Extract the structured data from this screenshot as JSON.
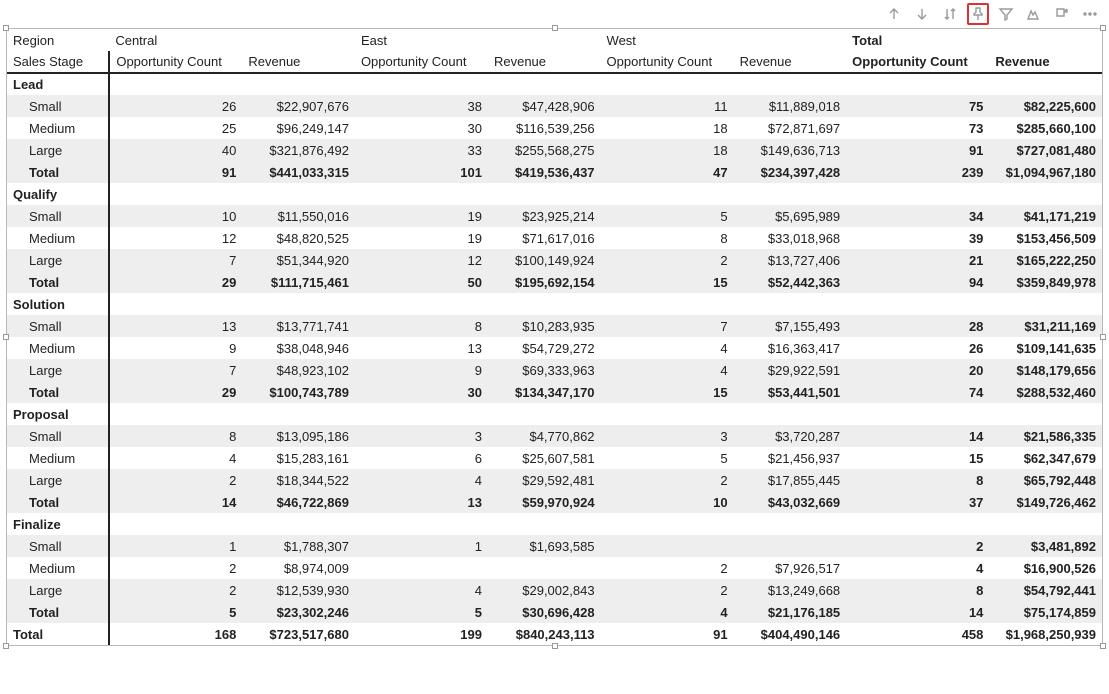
{
  "toolbar": {
    "icons": [
      "up",
      "down",
      "sort",
      "pin",
      "filter",
      "focus",
      "export",
      "more"
    ]
  },
  "headers": {
    "region_label": "Region",
    "sales_stage_label": "Sales Stage",
    "oc_label": "Opportunity Count",
    "rev_label": "Revenue",
    "regions": [
      "Central",
      "East",
      "West",
      "Total"
    ]
  },
  "stages": [
    {
      "name": "Lead",
      "rows": [
        {
          "label": "Small",
          "cells": [
            "26",
            "$22,907,676",
            "38",
            "$47,428,906",
            "11",
            "$11,889,018",
            "75",
            "$82,225,600"
          ]
        },
        {
          "label": "Medium",
          "cells": [
            "25",
            "$96,249,147",
            "30",
            "$116,539,256",
            "18",
            "$72,871,697",
            "73",
            "$285,660,100"
          ]
        },
        {
          "label": "Large",
          "cells": [
            "40",
            "$321,876,492",
            "33",
            "$255,568,275",
            "18",
            "$149,636,713",
            "91",
            "$727,081,480"
          ]
        }
      ],
      "subtotal": {
        "label": "Total",
        "cells": [
          "91",
          "$441,033,315",
          "101",
          "$419,536,437",
          "47",
          "$234,397,428",
          "239",
          "$1,094,967,180"
        ]
      }
    },
    {
      "name": "Qualify",
      "rows": [
        {
          "label": "Small",
          "cells": [
            "10",
            "$11,550,016",
            "19",
            "$23,925,214",
            "5",
            "$5,695,989",
            "34",
            "$41,171,219"
          ]
        },
        {
          "label": "Medium",
          "cells": [
            "12",
            "$48,820,525",
            "19",
            "$71,617,016",
            "8",
            "$33,018,968",
            "39",
            "$153,456,509"
          ]
        },
        {
          "label": "Large",
          "cells": [
            "7",
            "$51,344,920",
            "12",
            "$100,149,924",
            "2",
            "$13,727,406",
            "21",
            "$165,222,250"
          ]
        }
      ],
      "subtotal": {
        "label": "Total",
        "cells": [
          "29",
          "$111,715,461",
          "50",
          "$195,692,154",
          "15",
          "$52,442,363",
          "94",
          "$359,849,978"
        ]
      }
    },
    {
      "name": "Solution",
      "rows": [
        {
          "label": "Small",
          "cells": [
            "13",
            "$13,771,741",
            "8",
            "$10,283,935",
            "7",
            "$7,155,493",
            "28",
            "$31,211,169"
          ]
        },
        {
          "label": "Medium",
          "cells": [
            "9",
            "$38,048,946",
            "13",
            "$54,729,272",
            "4",
            "$16,363,417",
            "26",
            "$109,141,635"
          ]
        },
        {
          "label": "Large",
          "cells": [
            "7",
            "$48,923,102",
            "9",
            "$69,333,963",
            "4",
            "$29,922,591",
            "20",
            "$148,179,656"
          ]
        }
      ],
      "subtotal": {
        "label": "Total",
        "cells": [
          "29",
          "$100,743,789",
          "30",
          "$134,347,170",
          "15",
          "$53,441,501",
          "74",
          "$288,532,460"
        ]
      }
    },
    {
      "name": "Proposal",
      "rows": [
        {
          "label": "Small",
          "cells": [
            "8",
            "$13,095,186",
            "3",
            "$4,770,862",
            "3",
            "$3,720,287",
            "14",
            "$21,586,335"
          ]
        },
        {
          "label": "Medium",
          "cells": [
            "4",
            "$15,283,161",
            "6",
            "$25,607,581",
            "5",
            "$21,456,937",
            "15",
            "$62,347,679"
          ]
        },
        {
          "label": "Large",
          "cells": [
            "2",
            "$18,344,522",
            "4",
            "$29,592,481",
            "2",
            "$17,855,445",
            "8",
            "$65,792,448"
          ]
        }
      ],
      "subtotal": {
        "label": "Total",
        "cells": [
          "14",
          "$46,722,869",
          "13",
          "$59,970,924",
          "10",
          "$43,032,669",
          "37",
          "$149,726,462"
        ]
      }
    },
    {
      "name": "Finalize",
      "rows": [
        {
          "label": "Small",
          "cells": [
            "1",
            "$1,788,307",
            "1",
            "$1,693,585",
            "",
            "",
            "2",
            "$3,481,892"
          ]
        },
        {
          "label": "Medium",
          "cells": [
            "2",
            "$8,974,009",
            "",
            "",
            "2",
            "$7,926,517",
            "4",
            "$16,900,526"
          ]
        },
        {
          "label": "Large",
          "cells": [
            "2",
            "$12,539,930",
            "4",
            "$29,002,843",
            "2",
            "$13,249,668",
            "8",
            "$54,792,441"
          ]
        }
      ],
      "subtotal": {
        "label": "Total",
        "cells": [
          "5",
          "$23,302,246",
          "5",
          "$30,696,428",
          "4",
          "$21,176,185",
          "14",
          "$75,174,859"
        ]
      }
    }
  ],
  "grand_total": {
    "label": "Total",
    "cells": [
      "168",
      "$723,517,680",
      "199",
      "$840,243,113",
      "91",
      "$404,490,146",
      "458",
      "$1,968,250,939"
    ]
  }
}
